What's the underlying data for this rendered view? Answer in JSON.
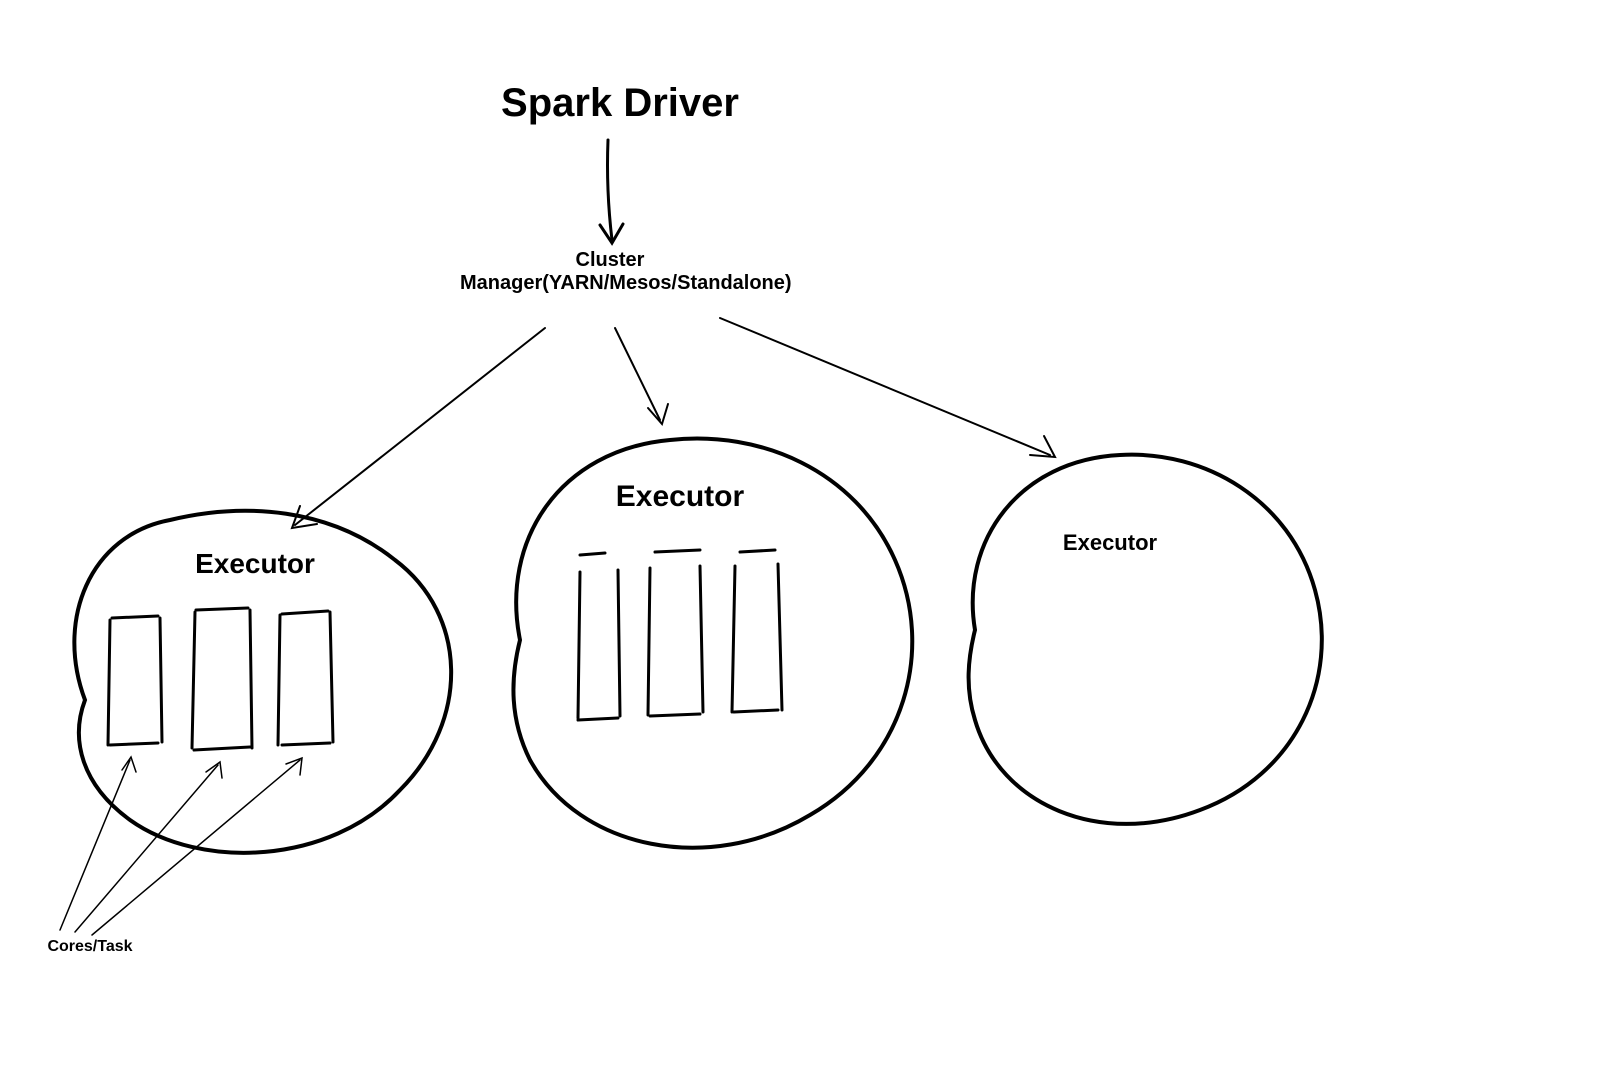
{
  "title": "Spark Driver",
  "cluster_manager": "Cluster\nManager(YARN/Mesos/Standalone)",
  "executors": {
    "left": {
      "label": "Executor"
    },
    "middle": {
      "label": "Executor"
    },
    "right": {
      "label": "Executor"
    }
  },
  "cores_label": "Cores/Task"
}
